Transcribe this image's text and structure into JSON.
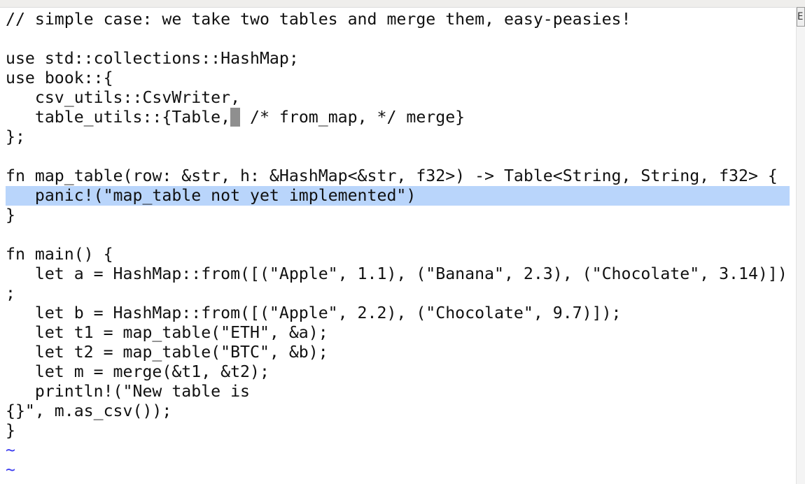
{
  "editor": {
    "lines": [
      "// simple case: we take two tables and merge them, easy-peasies!",
      "",
      "use std::collections::HashMap;",
      "use book::{",
      "   csv_utils::CsvWriter,",
      "   table_utils::{Table,",
      "};",
      "",
      "fn map_table(row: &str, h: &HashMap<&str, f32>) -> Table<String, String, f32> {",
      "   panic!(\"map_table not yet implemented\")",
      "}",
      "",
      "fn main() {",
      "   let a = HashMap::from([(\"Apple\", 1.1), (\"Banana\", 2.3), (\"Chocolate\", 3.14)])",
      ";",
      "   let b = HashMap::from([(\"Apple\", 2.2), (\"Chocolate\", 9.7)]);",
      "   let t1 = map_table(\"ETH\", &a);",
      "   let t2 = map_table(\"BTC\", &b);",
      "   let m = merge(&t1, &t2);",
      "   println!(\"New table is",
      "{}\", m.as_csv());",
      "}",
      "~",
      "~"
    ],
    "cursor_line_rest": " /* from_map, */ merge}",
    "cursor_char": " ",
    "highlight_color": "#b9d5fb",
    "tilde_color": "#3b3bf0",
    "scroll_icon": "E"
  }
}
